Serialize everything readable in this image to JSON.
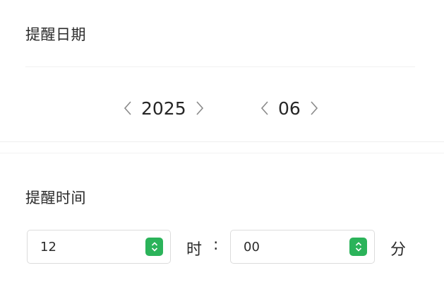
{
  "date_section": {
    "title": "提醒日期",
    "year": "2025",
    "month": "06"
  },
  "time_section": {
    "title": "提醒时间",
    "hour_value": "12",
    "hour_unit": "时",
    "separator": ":",
    "minute_value": "00",
    "minute_unit": "分"
  },
  "icons": {
    "prev": "chevron-left-icon",
    "next": "chevron-right-icon",
    "stepper": "up-down-stepper-icon"
  },
  "colors": {
    "accent": "#2bb35a",
    "text": "#262626",
    "chevron": "#8a8a8a",
    "border": "#dcdcdc"
  }
}
